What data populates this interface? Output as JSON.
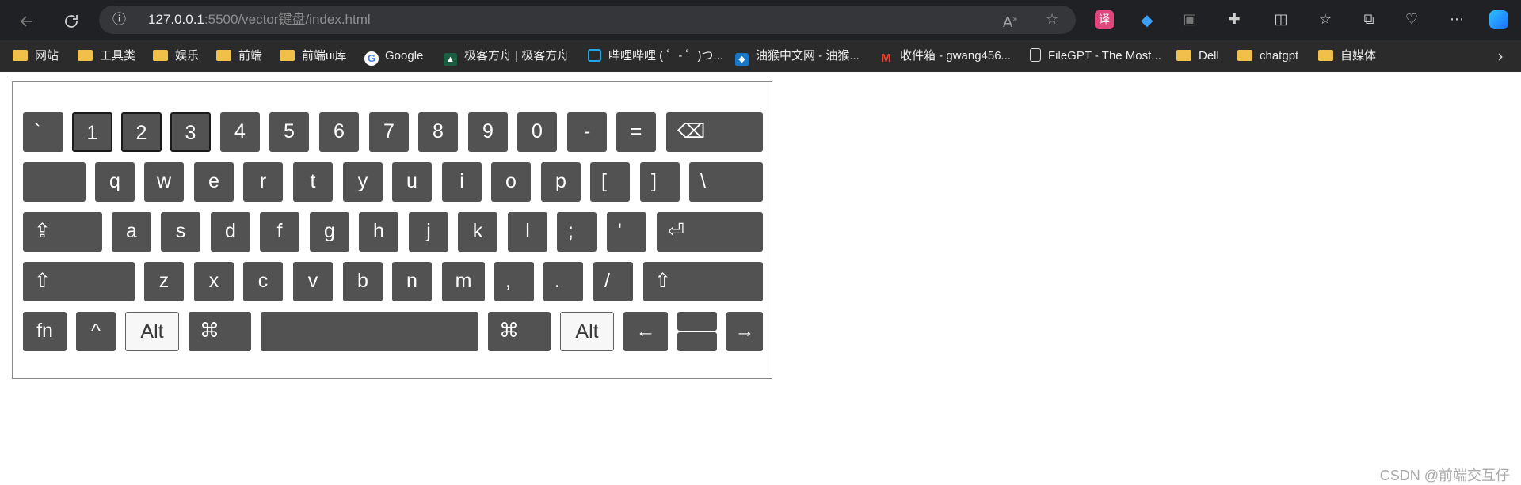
{
  "browser": {
    "url_host": "127.0.0.1",
    "url_path": ":5500/vector键盘/index.html",
    "back_icon": "arrow-left-icon",
    "reload_icon": "reload-icon",
    "info_icon": "info-icon",
    "read_aloud_icon": "read-aloud-icon",
    "favorite_icon": "star-icon",
    "menu_icon": "more-icon"
  },
  "bookmarks": [
    {
      "label": "网站",
      "icon": "folder-icon"
    },
    {
      "label": "工具类",
      "icon": "folder-icon"
    },
    {
      "label": "娱乐",
      "icon": "folder-icon"
    },
    {
      "label": "前端",
      "icon": "folder-icon"
    },
    {
      "label": "前端ui库",
      "icon": "folder-icon"
    },
    {
      "label": "Google",
      "icon": "google-icon"
    },
    {
      "label": "极客方舟 | 极客方舟",
      "icon": "geek-icon"
    },
    {
      "label": "哔哩哔哩 ( ゜- ゜)つ...",
      "icon": "bilibili-icon"
    },
    {
      "label": "油猴中文网 - 油猴...",
      "icon": "tampermonkey-icon"
    },
    {
      "label": "收件箱 - gwang456...",
      "icon": "gmail-icon"
    },
    {
      "label": "FileGPT - The Most...",
      "icon": "file-icon"
    },
    {
      "label": "Dell",
      "icon": "folder-icon"
    },
    {
      "label": "chatgpt",
      "icon": "folder-icon"
    },
    {
      "label": "自媒体",
      "icon": "folder-icon"
    }
  ],
  "keyboard": {
    "rows": [
      [
        "`",
        "1",
        "2",
        "3",
        "4",
        "5",
        "6",
        "7",
        "8",
        "9",
        "0",
        "-",
        "=",
        "⌫"
      ],
      [
        "",
        "q",
        "w",
        "e",
        "r",
        "t",
        "y",
        "u",
        "i",
        "o",
        "p",
        "[",
        "]",
        "\\"
      ],
      [
        "⇪",
        "a",
        "s",
        "d",
        "f",
        "g",
        "h",
        "j",
        "k",
        "l",
        ";",
        "'",
        "⏎"
      ],
      [
        "⇧",
        "z",
        "x",
        "c",
        "v",
        "b",
        "n",
        "m",
        ",",
        ".",
        "/",
        "⇧"
      ],
      [
        "fn",
        "^",
        "Alt",
        "⌘",
        "",
        "⌘",
        "Alt",
        "←",
        "",
        "→"
      ]
    ]
  },
  "watermark": "CSDN @前端交互仔"
}
